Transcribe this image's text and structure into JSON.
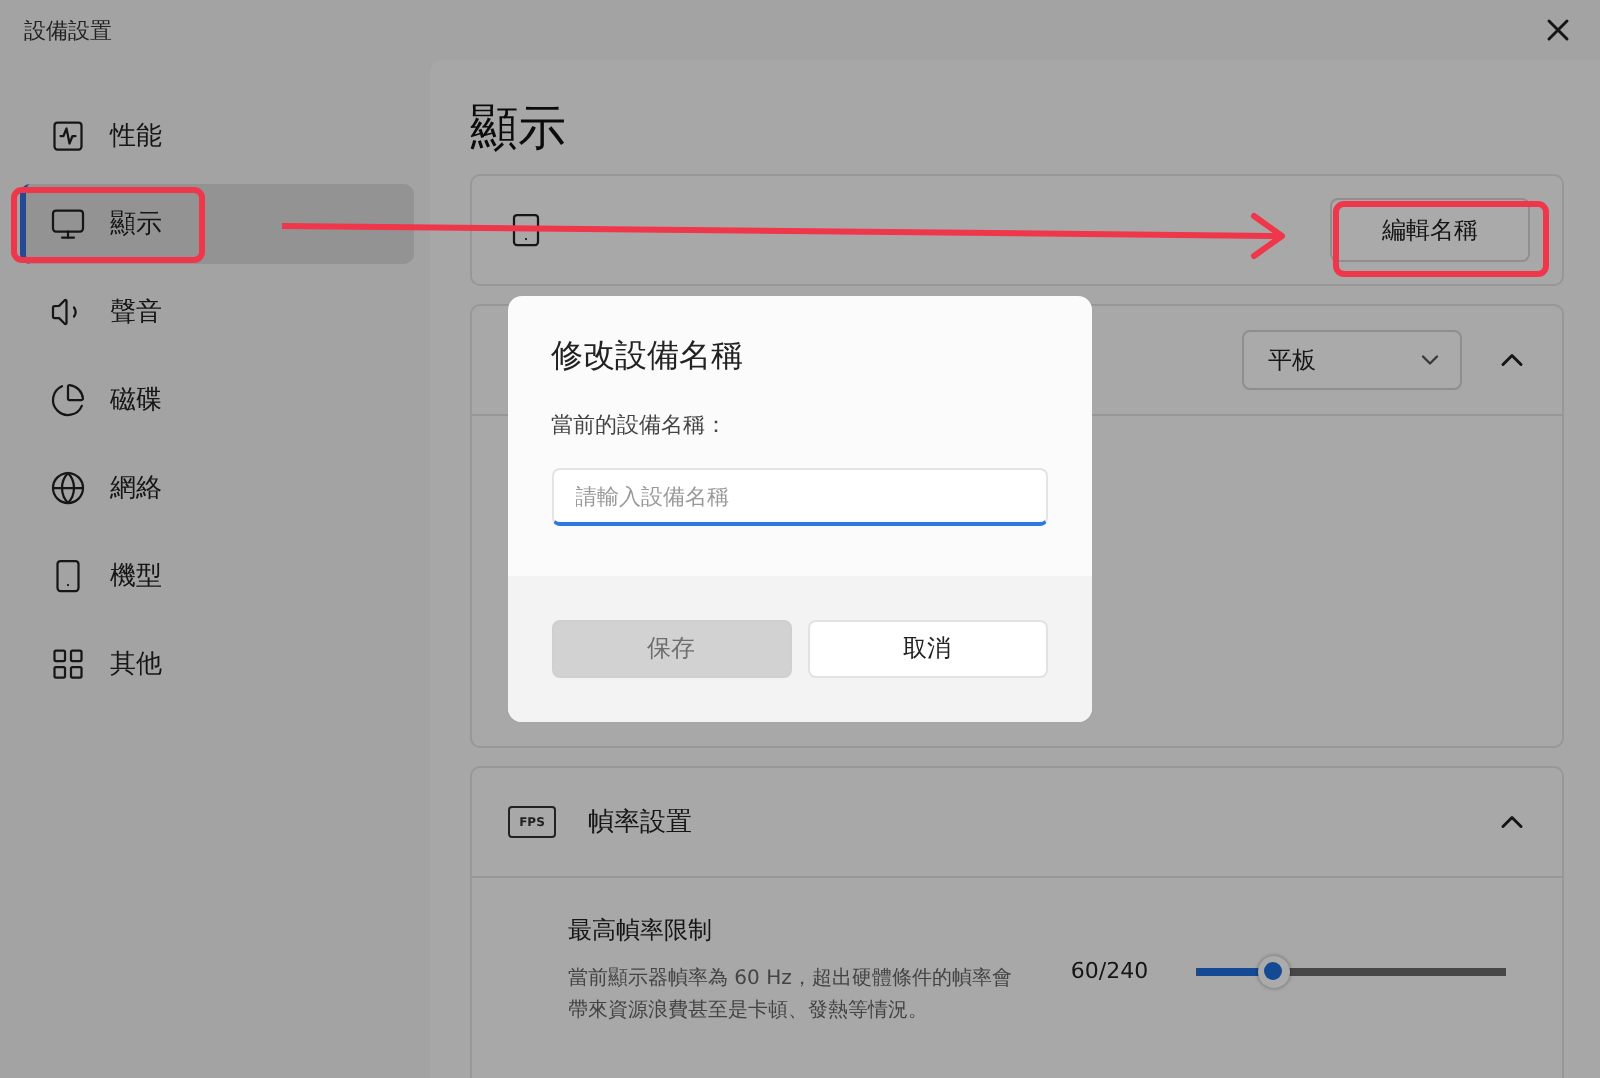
{
  "window": {
    "title": "設備設置"
  },
  "sidebar": {
    "items": [
      {
        "label": "性能",
        "selected": false
      },
      {
        "label": "顯示",
        "selected": true
      },
      {
        "label": "聲音",
        "selected": false
      },
      {
        "label": "磁碟",
        "selected": false
      },
      {
        "label": "網絡",
        "selected": false
      },
      {
        "label": "機型",
        "selected": false
      },
      {
        "label": "其他",
        "selected": false
      }
    ]
  },
  "page": {
    "title": "顯示"
  },
  "device_card": {
    "button": "編輯名稱"
  },
  "type_card": {
    "dropdown": {
      "value": "平板"
    },
    "expanded": true
  },
  "fps_card": {
    "icon_label": "FPS",
    "title": "幀率設置",
    "expanded": true,
    "setting": {
      "title": "最高幀率限制",
      "description": "當前顯示器幀率為 60 Hz，超出硬體條件的幀率會帶來資源浪費甚至是卡頓、發熱等情況。",
      "reading": "60/240",
      "level": 0.25
    }
  },
  "dialog": {
    "title": "修改設備名稱",
    "label": "當前的設備名稱：",
    "input": {
      "placeholder": "請輸入設備名稱"
    },
    "buttons": [
      {
        "label": "保存",
        "disabled": true
      },
      {
        "label": "取消",
        "disabled": false
      }
    ]
  }
}
